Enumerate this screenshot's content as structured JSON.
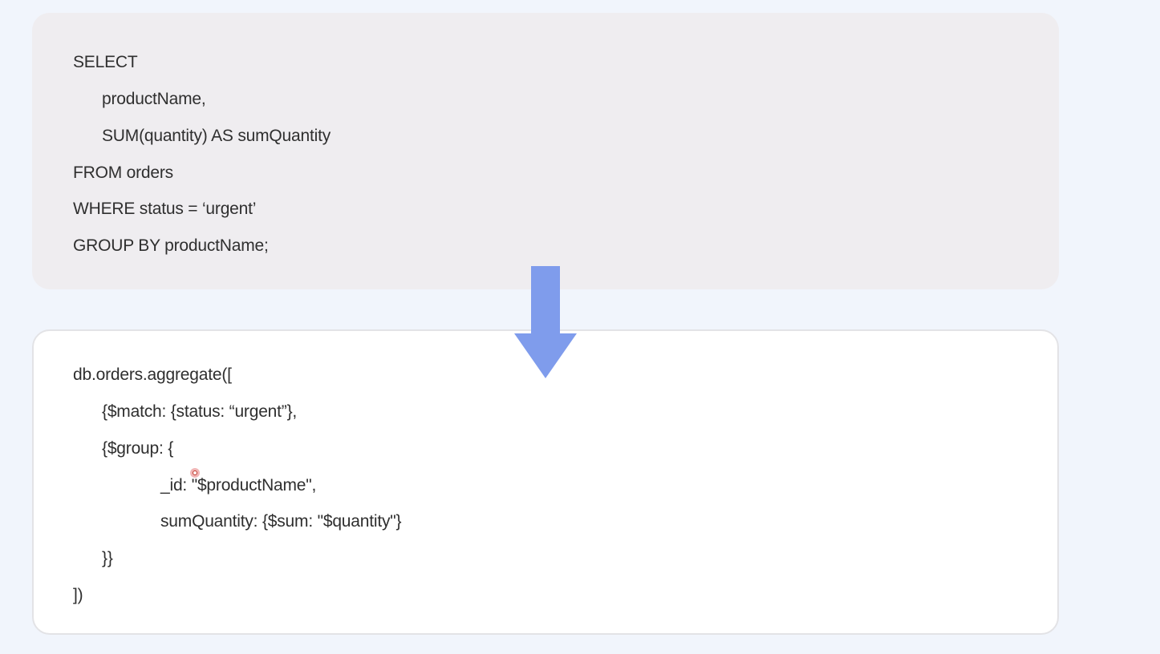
{
  "sql_query": {
    "lines": [
      "SELECT",
      "productName,",
      "SUM(quantity) AS sumQuantity",
      "FROM orders",
      "WHERE status = ‘urgent’",
      "GROUP BY productName;"
    ]
  },
  "mongo_query": {
    "lines": [
      "db.orders.aggregate([",
      "{$match: {status: “urgent”},",
      "{$group: {",
      "_id: \"$productName\",",
      "sumQuantity: {$sum: \"$quantity\"}",
      "}}",
      "])"
    ]
  },
  "colors": {
    "page_background": "#f1f5fc",
    "sql_panel": "#efedf0",
    "mongo_panel": "#ffffff",
    "arrow": "#7f9cec",
    "text": "#2f2f2f"
  },
  "icons": {
    "arrow": "arrow-down-icon",
    "cursor": "cursor-indicator-icon"
  }
}
